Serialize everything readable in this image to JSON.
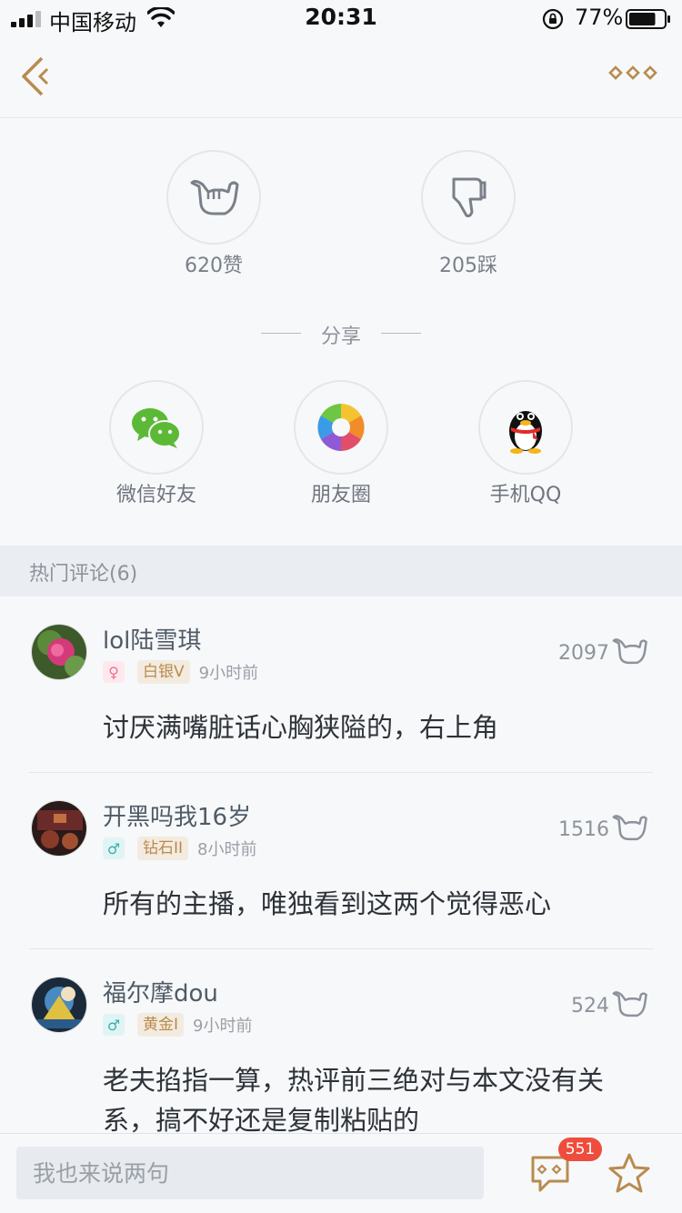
{
  "status_bar": {
    "carrier": "中国移动",
    "time": "20:31",
    "battery": "77%",
    "battery_level": 0.77
  },
  "colors": {
    "accent_gold": "#b98b4e",
    "badge_red": "#ee4d3d",
    "icon_gray": "#8d939b"
  },
  "nav": {
    "back_icon": "double-chevron-left-icon",
    "more_icon": "more-diamonds-icon"
  },
  "reactions": {
    "like": {
      "icon": "shaka-hand-icon",
      "label": "620赞"
    },
    "dislike": {
      "icon": "thumbs-down-icon",
      "label": "205踩"
    }
  },
  "share": {
    "title": "分享",
    "options": [
      {
        "icon": "wechat-icon",
        "label": "微信好友"
      },
      {
        "icon": "moments-icon",
        "label": "朋友圈"
      },
      {
        "icon": "qq-penguin-icon",
        "label": "手机QQ"
      }
    ]
  },
  "hot_comments": {
    "title": "热门评论(6)",
    "items": [
      {
        "username": "lol陆雪琪",
        "gender": "female",
        "gender_symbol": "♀",
        "level": "白银V",
        "time": "9小时前",
        "likes": "2097",
        "text": "讨厌满嘴脏话心胸狭隘的，右上角"
      },
      {
        "username": "开黑吗我16岁",
        "gender": "male",
        "gender_symbol": "♂",
        "level": "钻石II",
        "time": "8小时前",
        "likes": "1516",
        "text": "所有的主播，唯独看到这两个觉得恶心"
      },
      {
        "username": "福尔摩dou",
        "gender": "male",
        "gender_symbol": "♂",
        "level": "黄金I",
        "time": "9小时前",
        "likes": "524",
        "text": "老夫掐指一算，热评前三绝对与本文没有关系，搞不好还是复制粘贴的"
      }
    ]
  },
  "bottom_bar": {
    "placeholder": "我也来说两句",
    "comment_count": "551",
    "comment_icon": "comment-bubble-icon",
    "favorite_icon": "star-icon"
  }
}
